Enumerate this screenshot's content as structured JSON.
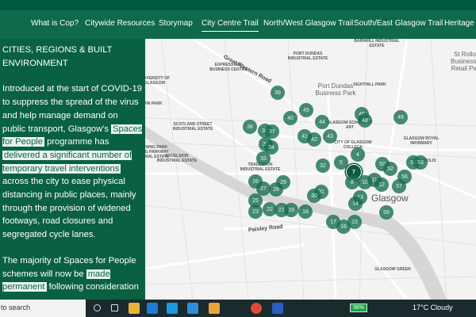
{
  "nav": {
    "items": [
      "What is Cop?",
      "Citywide Resources",
      "Storymap",
      "City Centre Trail",
      "North/West Glasgow Trail",
      "South/East Glasgow Trail",
      "Heritage Trail"
    ],
    "active_index": 3
  },
  "panel": {
    "heading": "CITIES, REGIONS & BUILT ENVIRONMENT",
    "p1": {
      "a": "Introduced at the start of COVID-19 to suppress the spread of the virus and help manage demand on public transport, Glasgow's ",
      "h1": "Spaces for People",
      "b": " programme has ",
      "h2": "delivered a significant number of temporary travel interventions",
      "c": " across the city to ease physical distancing in public places, mainly through the provision of widened footways, road closures and segregated cycle lanes."
    },
    "p2": {
      "a": "The majority of Spaces for People schemes will now be ",
      "h1": "made permanent",
      "b": " following consideration"
    }
  },
  "map": {
    "roads": [
      "Great Western Road",
      "Paisley Road"
    ],
    "labels": [
      "UNIVERSITY OF GLASGOW",
      "GLASGOW SCHOOL OF ART",
      "PORT DUNDAS INDUSTRIAL ESTATE",
      "BARNHILL INDUSTRIAL ESTATE",
      "SIGHTHILL PARK",
      "CITY OF GLASGOW COLLEGE",
      "GLASGOW ROYAL INFIRMARY",
      "NECROPOLIS",
      "EXPRESSWAY BUSINESS CENTRE",
      "SCOTLAND STREET INDUSTRIAL ESTATE",
      "EXCELSIOR INDUSTRIAL ESTATE",
      "TRADESTON INDUSTRIAL ESTATE",
      "GLASGOW GREEN",
      "KELVIN PARK",
      "KINNING PARK",
      "CANNING PARKWAY INDUSTRIAL ESTATE"
    ],
    "places": [
      "Port Dundas Business Park",
      "St Rollox Business & Retail Park",
      "Glasgow"
    ],
    "markers": [
      "39",
      "45",
      "40",
      "44",
      "46",
      "48",
      "49",
      "38",
      "36",
      "37",
      "41",
      "42",
      "43",
      "35",
      "34",
      "33",
      "32",
      "5",
      "4",
      "7",
      "50",
      "52",
      "58",
      "53",
      "56",
      "57",
      "8",
      "10",
      "11",
      "12",
      "26",
      "27",
      "28",
      "29",
      "31",
      "30",
      "25",
      "23",
      "22",
      "21",
      "19",
      "18",
      "13",
      "14",
      "59",
      "17",
      "16",
      "15"
    ],
    "selected_marker": "7"
  },
  "taskbar": {
    "search_placeholder": "to search",
    "battery": "98%",
    "weather": "17°C  Cloudy",
    "icons": [
      "cortana-icon",
      "task-view-icon",
      "file-explorer-icon",
      "app-l-icon",
      "edge-icon",
      "mail-icon",
      "store-icon",
      "chrome-icon",
      "word-icon"
    ]
  },
  "colors": {
    "brand": "#0a6142",
    "marker": "#186e50"
  }
}
